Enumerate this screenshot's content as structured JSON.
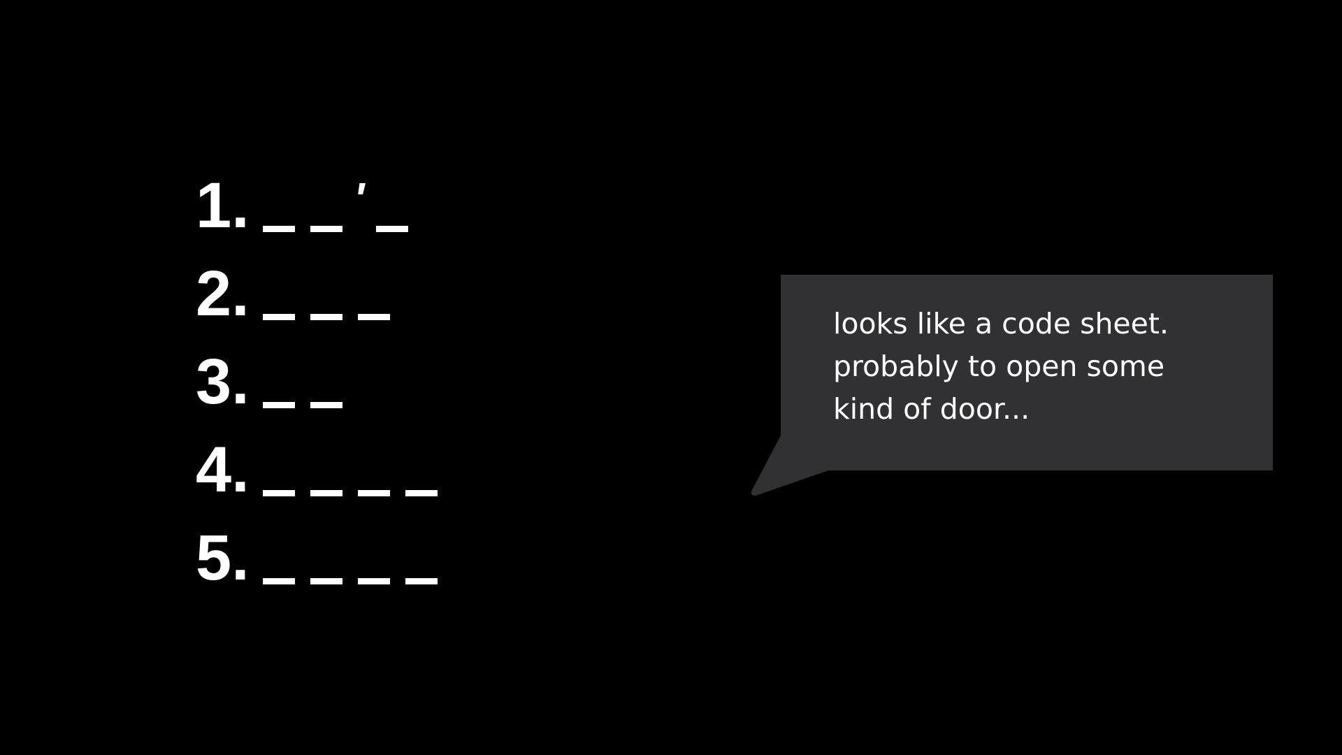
{
  "code_sheet": {
    "lines": [
      {
        "number": "1.",
        "pattern": [
          "_",
          "_",
          "'",
          "_"
        ]
      },
      {
        "number": "2.",
        "pattern": [
          "_",
          "_",
          "_"
        ]
      },
      {
        "number": "3.",
        "pattern": [
          "_",
          "_"
        ]
      },
      {
        "number": "4.",
        "pattern": [
          "_",
          "_",
          "_",
          "_"
        ]
      },
      {
        "number": "5.",
        "pattern": [
          "_",
          "_",
          "_",
          "_"
        ]
      }
    ]
  },
  "speech_bubble": {
    "lines": [
      "looks like a code sheet.",
      "probably to open some",
      "kind of door..."
    ]
  },
  "colors": {
    "background": "#000000",
    "text": "#ffffff",
    "bubble": "#313133"
  }
}
